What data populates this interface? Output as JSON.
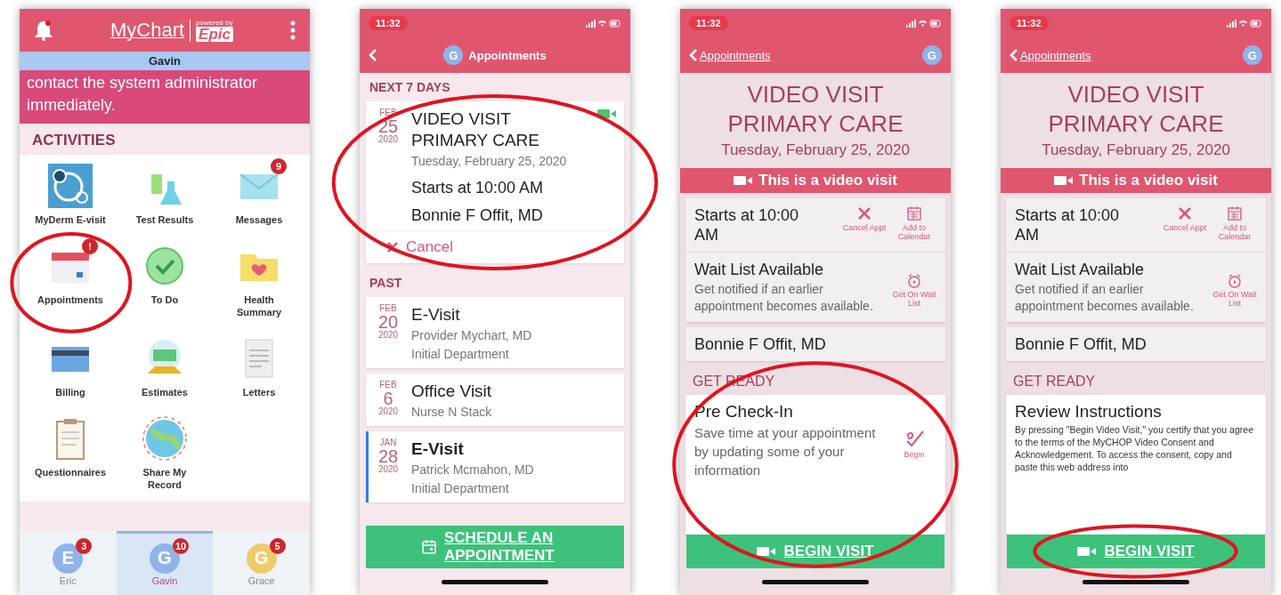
{
  "phones": [
    {
      "kind": "home",
      "logo": {
        "name": "MyChart",
        "tagline": "powered by",
        "brand": "Epic"
      },
      "profile": "Gavin",
      "alert": "contact the system administrator immediately.",
      "section": "ACTIVITIES",
      "activities": [
        {
          "label": "MyDerm E-visit"
        },
        {
          "label": "Test Results"
        },
        {
          "label": "Messages",
          "badge": "9"
        },
        {
          "label": "Appointments",
          "badge": "!",
          "circled": true
        },
        {
          "label": "To Do"
        },
        {
          "label": "Health Summary"
        },
        {
          "label": "Billing"
        },
        {
          "label": "Estimates"
        },
        {
          "label": "Letters"
        },
        {
          "label": "Questionnaires"
        },
        {
          "label": "Share My Record"
        }
      ],
      "accounts": [
        {
          "initial": "E",
          "name": "Eric",
          "badge": "3",
          "color": "#8fb4e8",
          "selected": false
        },
        {
          "initial": "G",
          "name": "Gavin",
          "badge": "10",
          "color": "#8fb4e8",
          "selected": true
        },
        {
          "initial": "G",
          "name": "Grace",
          "badge": "5",
          "color": "#eccb6a",
          "selected": false
        }
      ]
    },
    {
      "kind": "list",
      "time": "11:32",
      "title": "Appointments",
      "avatar": {
        "initial": "G",
        "color": "#8fb4e8"
      },
      "sections": [
        {
          "title": "NEXT 7 DAYS",
          "items": [
            {
              "month": "FEB",
              "day": "25",
              "year": "2020",
              "title": "VIDEO VISIT PRIMARY CARE",
              "lines": [
                "Tuesday, February 25, 2020"
              ],
              "start": "Starts at 10:00 AM",
              "provider": "Bonnie F Offit, MD",
              "cancel": "Cancel",
              "video": true,
              "accent": false,
              "circled": true
            }
          ]
        },
        {
          "title": "PAST",
          "items": [
            {
              "month": "FEB",
              "day": "20",
              "year": "2020",
              "title": "E-Visit",
              "lines": [
                "Provider Mychart, MD",
                "Initial Department"
              ],
              "accent": false
            },
            {
              "month": "FEB",
              "day": "6",
              "year": "2020",
              "title": "Office Visit",
              "lines": [
                "Nurse N Stack"
              ],
              "accent": false
            },
            {
              "month": "JAN",
              "day": "28",
              "year": "2020",
              "title": "E-Visit",
              "lines": [
                "Patrick Mcmahon, MD",
                "Initial Department"
              ],
              "accent": true
            }
          ]
        }
      ],
      "button": "SCHEDULE AN APPOINTMENT"
    },
    {
      "kind": "detail",
      "time": "11:32",
      "back": "Appointments",
      "avatar": {
        "initial": "G",
        "color": "#8fb4e8"
      },
      "title": "VIDEO VISIT PRIMARY CARE",
      "date": "Tuesday, February 25, 2020",
      "banner": "This is a video visit",
      "start": "Starts at 10:00 AM",
      "actions": [
        {
          "label": "Cancel Appt"
        },
        {
          "label": "Add to Calendar"
        }
      ],
      "waitlist": {
        "title": "Wait List Available",
        "text": "Get notified if an earlier appointment becomes available.",
        "action": "Get On Wait List"
      },
      "provider": "Bonnie F Offit, MD",
      "section": "GET READY",
      "task": {
        "title": "Pre Check-In",
        "text": "Save time at your appointment by updating some of your information",
        "action": "Begin",
        "circled": true
      },
      "button": {
        "label": "BEGIN VISIT"
      }
    },
    {
      "kind": "detail",
      "time": "11:32",
      "back": "Appointments",
      "avatar": {
        "initial": "G",
        "color": "#8fb4e8"
      },
      "title": "VIDEO VISIT PRIMARY CARE",
      "date": "Tuesday, February 25, 2020",
      "banner": "This is a video visit",
      "start": "Starts at 10:00 AM",
      "actions": [
        {
          "label": "Cancel Appt"
        },
        {
          "label": "Add to Calendar"
        }
      ],
      "waitlist": {
        "title": "Wait List Available",
        "text": "Get notified if an earlier appointment becomes available.",
        "action": "Get On Wait List"
      },
      "provider": "Bonnie F Offit, MD",
      "section": "GET READY",
      "task": {
        "title": "Review Instructions",
        "text": "By pressing \"Begin Video Visit,\" you certify that you agree to the terms of the MyCHOP Video Consent and Acknowledgement. To access the consent, copy and paste this web address into"
      },
      "button": {
        "label": "BEGIN VISIT",
        "circled": true
      }
    }
  ]
}
